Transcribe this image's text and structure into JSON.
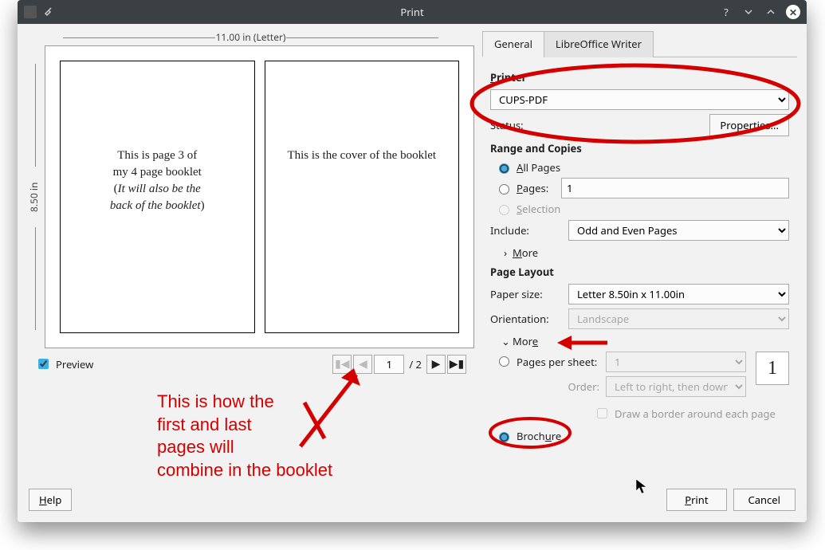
{
  "window": {
    "title": "Print"
  },
  "preview": {
    "ruler_top": "11.00 in (Letter)",
    "ruler_left": "8.50 in",
    "left_page": {
      "line1": "This is page 3 of",
      "line2": "my 4 page booklet",
      "line3_open": "(",
      "line3_em": "It will also be the",
      "line4_em": "back of the booklet",
      "line4_close": ")"
    },
    "right_page_text": "This is the cover of the booklet"
  },
  "tabs": {
    "general": "General",
    "writer": "LibreOffice Writer"
  },
  "printer": {
    "section": "Printer",
    "selected": "CUPS-PDF",
    "status_label": "Status:",
    "status_value": "",
    "properties_btn": "Properties..."
  },
  "range": {
    "section": "Range and Copies",
    "all_pages": "All Pages",
    "pages_label": "Pages:",
    "pages_value": "1",
    "selection": "Selection",
    "include_label": "Include:",
    "include_value": "Odd and Even Pages",
    "more": "More"
  },
  "layout": {
    "section": "Page Layout",
    "paper_label": "Paper size:",
    "paper_value": "Letter 8.50in x 11.00in",
    "orient_label": "Orientation:",
    "orient_value": "Landscape",
    "more": "More",
    "pps_label": "Pages per sheet:",
    "pps_value": "1",
    "order_label": "Order:",
    "order_value": "Left to right, then down",
    "thumb": "1",
    "border_label": "Draw a border around each page",
    "brochure": "Brochure"
  },
  "bottom": {
    "preview_check": "Preview",
    "page_current": "1",
    "page_total": "/ 2"
  },
  "footer": {
    "help": "Help",
    "print": "Print",
    "cancel": "Cancel"
  },
  "annotations": {
    "text": "This is how the\nfirst and last\npages will\ncombine in the booklet"
  }
}
